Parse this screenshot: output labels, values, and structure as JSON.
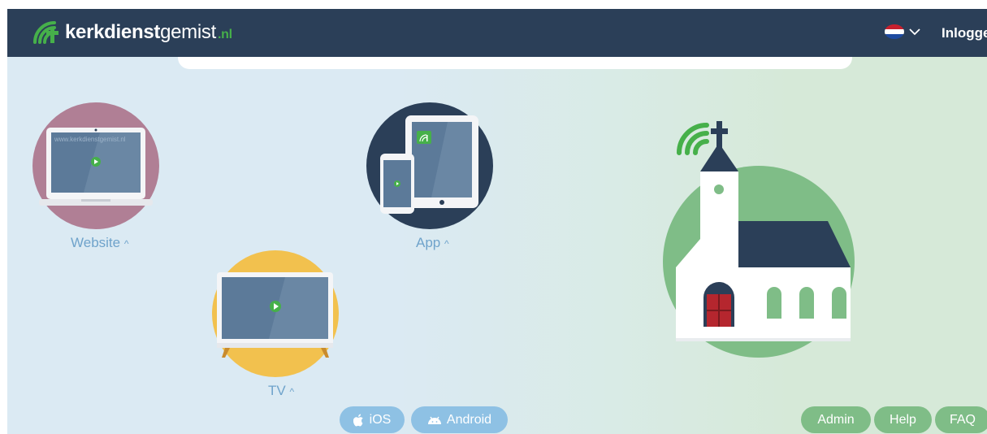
{
  "header": {
    "brand_bold": "kerkdienst",
    "brand_light": "gemist",
    "brand_tld": ".nl",
    "login_label": "Inloggen",
    "language_icon": "netherlands-flag-icon",
    "chevron_icon": "chevron-down-icon"
  },
  "devices": {
    "website": {
      "label": "Website",
      "arrow": "^",
      "screen_url": "www.kerkdienstgemist.nl",
      "circle_color": "#b07f95"
    },
    "app": {
      "label": "App",
      "arrow": "^",
      "circle_color": "#2b3f58"
    },
    "tv": {
      "label": "TV",
      "arrow": "^",
      "circle_color": "#f2c14e"
    }
  },
  "store_buttons": {
    "ios": {
      "label": "iOS",
      "icon": "apple-icon"
    },
    "android": {
      "label": "Android",
      "icon": "android-icon"
    }
  },
  "footer_buttons": {
    "admin": "Admin",
    "help": "Help",
    "faq": "FAQ"
  },
  "colors": {
    "header_bg": "#2b3f58",
    "accent_green": "#46b04a",
    "church_circle": "#7fbd87",
    "church_door": "#b5262e",
    "label_blue": "#6fa3cb",
    "pill_blue": "#8ec1e4",
    "pill_green": "#7fbd87"
  }
}
